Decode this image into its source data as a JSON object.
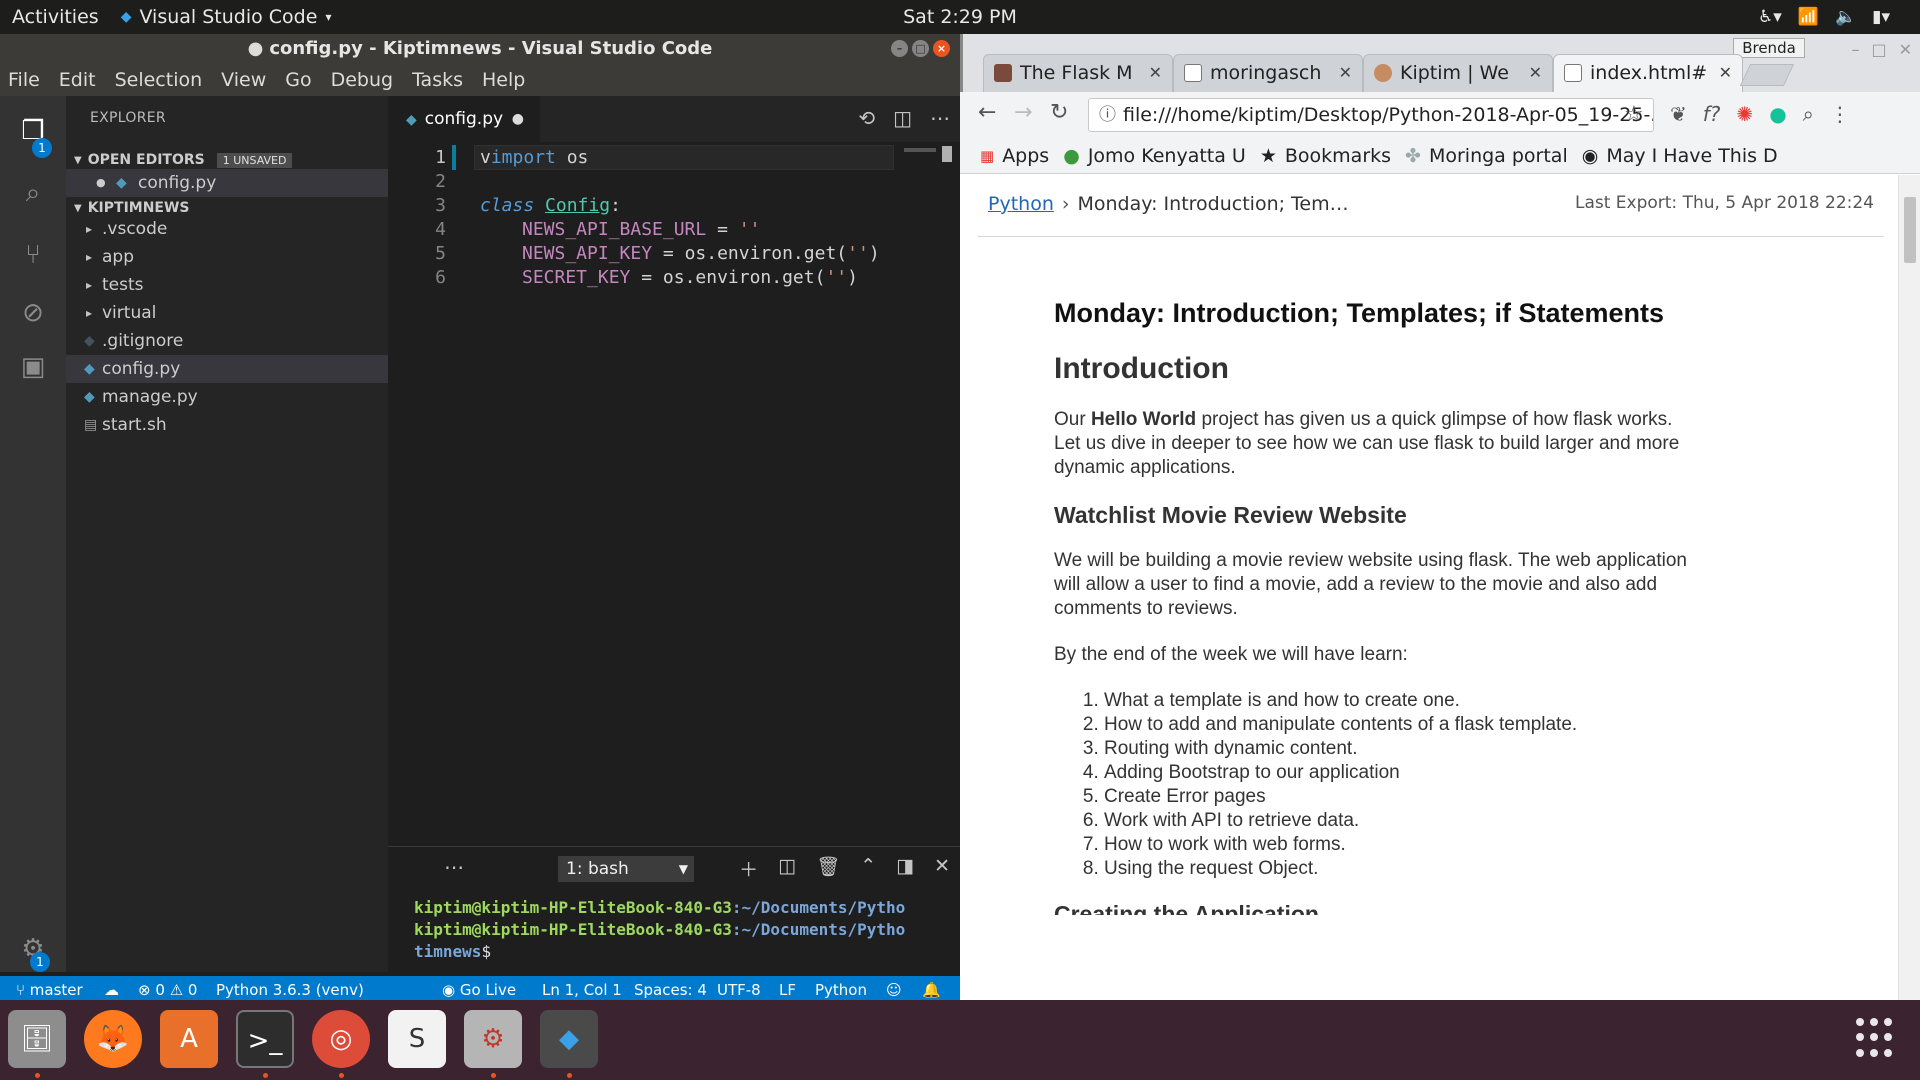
{
  "topbar": {
    "activities": "Activities",
    "app_name": "Visual Studio Code",
    "clock": "Sat  2:29 PM"
  },
  "vscode": {
    "title": "config.py - Kiptimnews - Visual Studio Code",
    "menu": [
      "File",
      "Edit",
      "Selection",
      "View",
      "Go",
      "Debug",
      "Tasks",
      "Help"
    ],
    "explorer_label": "EXPLORER",
    "activity_badges": {
      "explorer": "1",
      "settings": "1"
    },
    "open_editors": {
      "label": "OPEN EDITORS",
      "badge": "1 UNSAVED",
      "files": [
        "config.py"
      ]
    },
    "project": {
      "label": "KIPTIMNEWS",
      "items": [
        {
          "name": ".vscode",
          "type": "folder"
        },
        {
          "name": "app",
          "type": "folder"
        },
        {
          "name": "tests",
          "type": "folder"
        },
        {
          "name": "virtual",
          "type": "folder"
        },
        {
          "name": ".gitignore",
          "type": "file"
        },
        {
          "name": "config.py",
          "type": "python"
        },
        {
          "name": "manage.py",
          "type": "python"
        },
        {
          "name": "start.sh",
          "type": "file"
        }
      ]
    },
    "tab": {
      "label": "config.py"
    },
    "code": {
      "line_numbers": [
        "1",
        "2",
        "3",
        "4",
        "5",
        "6"
      ],
      "l1": {
        "kw": "import",
        "rest": " os",
        "cursor": "v"
      },
      "l3": {
        "kw": "class",
        "cls": "Config",
        "colon": ":"
      },
      "l4": {
        "var": "NEWS_API_BASE_URL",
        "op": " = ",
        "str": "''"
      },
      "l5": {
        "var": "NEWS_API_KEY",
        "op": " = ",
        "call": "os.environ.get(",
        "str": "''",
        "close": ")"
      },
      "l6": {
        "var": "SECRET_KEY",
        "op": " = ",
        "call": "os.environ.get(",
        "str": "''",
        "close": ")"
      }
    },
    "terminal": {
      "selector": "1: bash",
      "lines": [
        {
          "user": "kiptim@kiptim-HP-EliteBook-840-G3",
          "path": ":~/Documents/Pytho"
        },
        {
          "user": "kiptim@kiptim-HP-EliteBook-840-G3",
          "path": ":~/Documents/Pytho"
        }
      ],
      "wrap": "timnews",
      "prompt": "$"
    },
    "status": {
      "branch": "master",
      "errors": "0",
      "warnings": "0",
      "interpreter": "Python 3.6.3 (venv)",
      "golive": "Go Live",
      "position": "Ln 1, Col 1",
      "spaces": "Spaces: 4",
      "encoding": "UTF-8",
      "eol": "LF",
      "language": "Python"
    }
  },
  "chrome": {
    "profile": "Brenda",
    "tabs": [
      {
        "label": "The Flask M",
        "active": false
      },
      {
        "label": "moringasch",
        "active": false
      },
      {
        "label": "Kiptim | We",
        "active": false
      },
      {
        "label": "index.html#",
        "active": true
      }
    ],
    "url": "file:///home/kiptim/Desktop/Python-2018-Apr-05_19-25-...",
    "bookmarks": [
      "Apps",
      "Jomo Kenyatta U",
      "Bookmarks",
      "Moringa portal",
      "May I Have This D"
    ],
    "page": {
      "crumb_link": "Python",
      "crumb_current": "Monday: Introduction; Tem…",
      "last_export": "Last Export: Thu, 5 Apr 2018 22:24",
      "h1": "Monday: Introduction; Templates; if Statements",
      "h2": "Introduction",
      "p1_pre": "Our ",
      "p1_bold": "Hello World",
      "p1_post": " project has given us a quick glimpse of how flask works. Let us dive in deeper to see how we can use flask to build larger and more dynamic applications.",
      "h3": "Watchlist Movie Review Website",
      "p2": "We will be building a movie review website using flask. The web application will allow a user to find a movie, add a review to the movie and also add comments to reviews.",
      "p3": "By the end of the week we will have learn:",
      "list": [
        "What a template is and how to create one.",
        "How to add and manipulate contents of a flask template.",
        "Routing with dynamic content.",
        "Adding Bootstrap to our application",
        "Create Error pages",
        "Work with API to retrieve data.",
        "How to work with web forms.",
        "Using the request Object."
      ],
      "cut_heading": "Creating the Application"
    }
  },
  "colors": {
    "vscode_blue": "#007acc",
    "ubuntu_orange": "#e95420",
    "dock_bg": "#3b2330"
  }
}
